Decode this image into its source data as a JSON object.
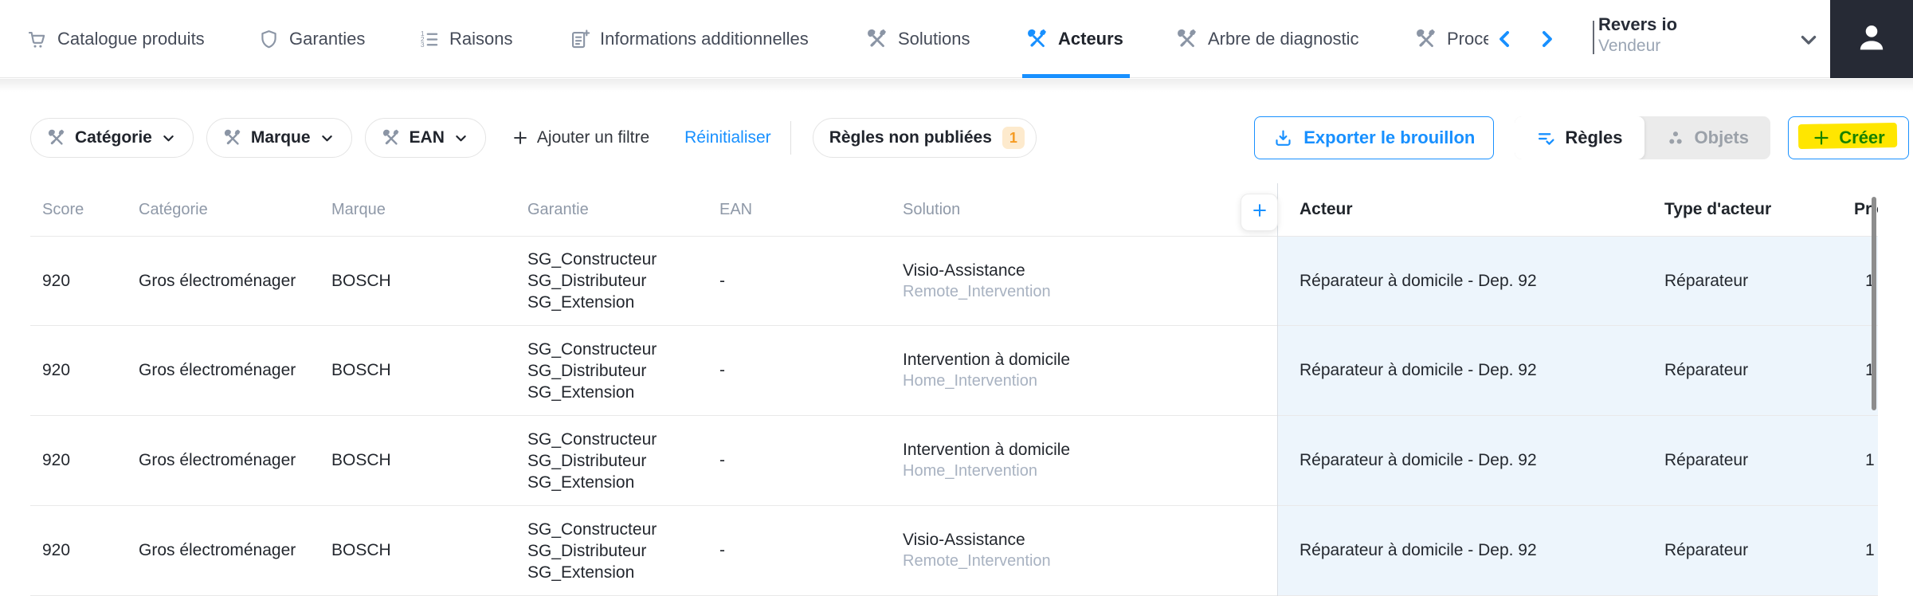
{
  "colors": {
    "accent": "#1890ff",
    "highlight_marker": "#ffe600",
    "badge_bg": "#fdeacd",
    "badge_text": "#f59b22",
    "pinned_column_bg": "#edf5fc",
    "avatar_bg": "#262a35"
  },
  "nav": {
    "tabs": [
      {
        "id": "catalogue-produits",
        "icon": "cart-icon",
        "label": "Catalogue produits",
        "active": false
      },
      {
        "id": "garanties",
        "icon": "shield-icon",
        "label": "Garanties",
        "active": false
      },
      {
        "id": "raisons",
        "icon": "ordered-list-icon",
        "label": "Raisons",
        "active": false
      },
      {
        "id": "informations-additionnelles",
        "icon": "document-add-icon",
        "label": "Informations additionnelles",
        "active": false
      },
      {
        "id": "solutions",
        "icon": "tools-icon",
        "label": "Solutions",
        "active": false
      },
      {
        "id": "acteurs",
        "icon": "tools-icon",
        "label": "Acteurs",
        "active": true
      },
      {
        "id": "arbre-de-diagnostic",
        "icon": "tools-icon",
        "label": "Arbre de diagnostic",
        "active": false
      },
      {
        "id": "procedures",
        "icon": "tools-icon",
        "label": "Proce",
        "active": false
      }
    ],
    "account": {
      "name": "Revers io",
      "role": "Vendeur"
    }
  },
  "filters": {
    "chips": [
      {
        "id": "categorie",
        "label": "Catégorie"
      },
      {
        "id": "marque",
        "label": "Marque"
      },
      {
        "id": "ean",
        "label": "EAN"
      }
    ],
    "add_filter_label": "Ajouter un filtre",
    "reset_label": "Réinitialiser",
    "unpublished": {
      "label": "Règles non publiées",
      "count": "1"
    }
  },
  "actions": {
    "export_label": "Exporter le brouillon",
    "toggle": {
      "rules_label": "Règles",
      "objects_label": "Objets"
    },
    "create_label": "Créer"
  },
  "table": {
    "headers": {
      "score": "Score",
      "category": "Catégorie",
      "brand": "Marque",
      "warranty": "Garantie",
      "ean": "EAN",
      "solution": "Solution",
      "actor": "Acteur",
      "actor_type": "Type d'acteur",
      "priority": "Prio"
    },
    "rows": [
      {
        "score": "920",
        "category": "Gros électroménager",
        "brand": "BOSCH",
        "warranties": [
          "SG_Constructeur",
          "SG_Distributeur",
          "SG_Extension"
        ],
        "ean": "-",
        "solution": {
          "name": "Visio-Assistance",
          "code": "Remote_Intervention"
        },
        "actor": "Réparateur à domicile - Dep. 92",
        "actor_type": "Réparateur",
        "priority": "1"
      },
      {
        "score": "920",
        "category": "Gros électroménager",
        "brand": "BOSCH",
        "warranties": [
          "SG_Constructeur",
          "SG_Distributeur",
          "SG_Extension"
        ],
        "ean": "-",
        "solution": {
          "name": "Intervention à domicile",
          "code": "Home_Intervention"
        },
        "actor": "Réparateur à domicile - Dep. 92",
        "actor_type": "Réparateur",
        "priority": "1"
      },
      {
        "score": "920",
        "category": "Gros électroménager",
        "brand": "BOSCH",
        "warranties": [
          "SG_Constructeur",
          "SG_Distributeur",
          "SG_Extension"
        ],
        "ean": "-",
        "solution": {
          "name": "Intervention à domicile",
          "code": "Home_Intervention"
        },
        "actor": "Réparateur à domicile - Dep. 92",
        "actor_type": "Réparateur",
        "priority": "1"
      },
      {
        "score": "920",
        "category": "Gros électroménager",
        "brand": "BOSCH",
        "warranties": [
          "SG_Constructeur",
          "SG_Distributeur",
          "SG_Extension"
        ],
        "ean": "-",
        "solution": {
          "name": "Visio-Assistance",
          "code": "Remote_Intervention"
        },
        "actor": "Réparateur à domicile - Dep. 92",
        "actor_type": "Réparateur",
        "priority": "1"
      }
    ]
  }
}
